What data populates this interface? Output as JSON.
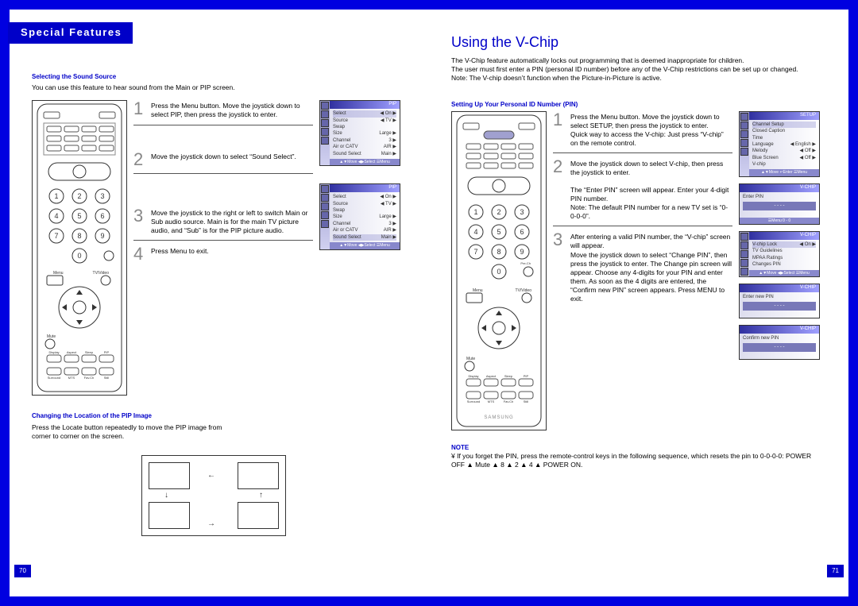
{
  "section_banner": "Special Features",
  "left_page": {
    "subheading1": "Selecting the Sound Source",
    "intro1": "You can use this feature to hear sound from the Main or PIP screen.",
    "steps1": [
      "Press the Menu button. Move the joystick down to select PIP, then press the joystick to enter.",
      "Move the joystick down to select “Sound Select”.",
      "Move the joystick to the right or left to switch Main or Sub audio source. Main is for the main TV picture audio, and “Sub” is for the PIP picture audio.",
      "Press Menu to exit."
    ],
    "subheading2": "Changing the Location of the PIP Image",
    "intro2": "Press the Locate button repeatedly to move the PIP image from corner to corner on the screen.",
    "osd_pip_title": "PIP",
    "osd_rows": [
      {
        "l": "Select",
        "r": "◀   On   ▶"
      },
      {
        "l": "Source",
        "r": "◀   TV   ▶"
      },
      {
        "l": "Swap",
        "r": ""
      },
      {
        "l": "Size",
        "r": "Large ▶"
      },
      {
        "l": "Channel",
        "r": "3    ▶"
      },
      {
        "l": "Air or CATV",
        "r": "AIR ▶"
      },
      {
        "l": "Sound Select",
        "r": "Main ▶"
      }
    ],
    "osd_hint": "▲▼Move   ◀▶Select   ☰Menu",
    "pagenum": "70"
  },
  "right_page": {
    "title": "Using the V-Chip",
    "intro": "The V-Chip feature automatically locks out programming that is deemed inappropriate for children.\nThe user must first enter a PIN (personal ID number) before any of the V-Chip restrictions can be set up or changed.\nNote: The V-chip doesn’t function when the Picture-in-Picture is active.",
    "subheading": "Setting Up Your Personal ID Number (PIN)",
    "steps": [
      "Press the Menu button.  Move the joystick down to select SETUP, then press the joystick to enter.\nQuick way to access the V-chip: Just press “V-chip” on the remote control.",
      "Move the joystick down to select V-chip, then press the joystick to enter.\n\nThe “Enter PIN” screen will appear. Enter your 4-digit PIN number.\nNote: The default PIN number for a new TV set is “0-0-0-0”.",
      "After entering a valid PIN number, the “V-chip” screen will appear.\nMove the joystick down to select “Change PIN”, then press the joystick to enter. The Change pin screen will appear. Choose any 4-digits for your PIN and enter them. As soon as the 4 digits are entered, the “Confirm new PIN” screen appears. Press MENU to exit."
    ],
    "note_heading": "NOTE",
    "note_body": "¥   If you forget the PIN, press the remote-control keys in the following sequence, which resets the pin to 0-0-0-0: POWER OFF ▲ Mute ▲ 8 ▲ 2 ▲ 4 ▲ POWER ON.",
    "osd_setup_title": "SETUP",
    "osd_setup_rows": [
      {
        "l": "Channel Setup",
        "r": ""
      },
      {
        "l": "Closed Caption",
        "r": ""
      },
      {
        "l": "Time",
        "r": ""
      },
      {
        "l": "Language",
        "r": "◀ English ▶"
      },
      {
        "l": "Melody",
        "r": "◀  Off  ▶"
      },
      {
        "l": "Blue Screen",
        "r": "◀  Off  ▶"
      },
      {
        "l": "V-chip",
        "r": ""
      }
    ],
    "osd_setup_hint": "▲▼Move  ↵Enter  ☰Menu",
    "osd_vchip_title": "V-CHIP",
    "osd_enterpin": "Enter PIN",
    "osd_dashes": "- - - -",
    "osd_vchip_hint": "☰Menu        0 - 0",
    "osd_vchip_rows": [
      {
        "l": "V-chip Lock",
        "r": "◀ On ▶"
      },
      {
        "l": "TV Guidelines",
        "r": ""
      },
      {
        "l": "MPAA Ratings",
        "r": ""
      },
      {
        "l": "Changes PIN",
        "r": ""
      }
    ],
    "osd_vchip_hint2": "▲▼Move  ◀▶Select  ☰Menu",
    "osd_newpin": "Enter new PIN",
    "osd_confirm": "Confirm new PIN",
    "pagenum": "71"
  }
}
